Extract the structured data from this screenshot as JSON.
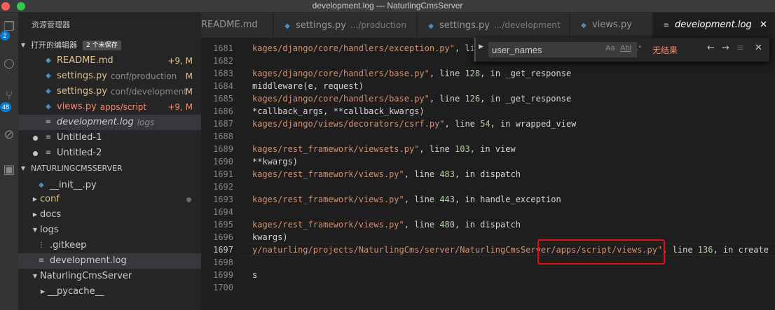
{
  "window": {
    "title": "development.log — NaturlingCmsServer"
  },
  "activity": {
    "badge_top": "2",
    "badge_scm": "48"
  },
  "sidebar": {
    "header": "资源管理器",
    "open_editors": {
      "title": "打开的编辑器",
      "unsaved": "2 个未保存",
      "items": [
        {
          "name": "README.md",
          "dir": "",
          "status": "+9, M"
        },
        {
          "name": "settings.py",
          "dir": "conf/production",
          "status": "M"
        },
        {
          "name": "settings.py",
          "dir": "conf/development",
          "status": "M"
        },
        {
          "name": "views.py",
          "dir": "apps/script",
          "status": "+9, M"
        },
        {
          "name": "development.log",
          "dir": "logs",
          "status": ""
        },
        {
          "name": "Untitled-1",
          "dir": "",
          "status": ""
        },
        {
          "name": "Untitled-2",
          "dir": "",
          "status": ""
        }
      ]
    },
    "project": {
      "title": "NATURLINGCMSSERVER",
      "items": [
        {
          "name": "__init__.py"
        },
        {
          "name": "conf"
        },
        {
          "name": "docs"
        },
        {
          "name": "logs"
        },
        {
          "name": ".gitkeep"
        },
        {
          "name": "development.log"
        },
        {
          "name": "NaturlingCmsServer"
        },
        {
          "name": "__pycache__"
        }
      ]
    }
  },
  "tabs": [
    {
      "label": "README.md",
      "desc": ""
    },
    {
      "label": "settings.py",
      "desc": ".../production"
    },
    {
      "label": "settings.py",
      "desc": ".../development"
    },
    {
      "label": "views.py",
      "desc": ""
    },
    {
      "label": "development.log",
      "desc": ""
    }
  ],
  "find": {
    "value": "user_names",
    "match_case": "Aa",
    "whole_word": "Abl",
    "regex": ".*",
    "no_results": "无结果"
  },
  "editor": {
    "lines": [
      {
        "n": "1681",
        "segs": [
          [
            "s",
            "kages/django/core/handlers/exception.py\""
          ],
          [
            "t",
            ", li"
          ]
        ]
      },
      {
        "n": "1682",
        "segs": []
      },
      {
        "n": "1683",
        "segs": [
          [
            "s",
            "kages/django/core/handlers/base.py\""
          ],
          [
            "t",
            ", line "
          ],
          [
            "n",
            "128"
          ],
          [
            "t",
            ", in _get_response"
          ]
        ]
      },
      {
        "n": "1684",
        "segs": [
          [
            "t",
            "middleware(e, request)"
          ]
        ]
      },
      {
        "n": "1685",
        "segs": [
          [
            "s",
            "kages/django/core/handlers/base.py\""
          ],
          [
            "t",
            ", line "
          ],
          [
            "n",
            "126"
          ],
          [
            "t",
            ", in _get_response"
          ]
        ]
      },
      {
        "n": "1686",
        "segs": [
          [
            "t",
            "*callback_args, **callback_kwargs)"
          ]
        ]
      },
      {
        "n": "1687",
        "segs": [
          [
            "s",
            "kages/django/views/decorators/csrf.py\""
          ],
          [
            "t",
            ", line "
          ],
          [
            "n",
            "54"
          ],
          [
            "t",
            ", in wrapped_view"
          ]
        ]
      },
      {
        "n": "1688",
        "segs": []
      },
      {
        "n": "1689",
        "segs": [
          [
            "s",
            "kages/rest_framework/viewsets.py\""
          ],
          [
            "t",
            ", line "
          ],
          [
            "n",
            "103"
          ],
          [
            "t",
            ", in view"
          ]
        ]
      },
      {
        "n": "1690",
        "segs": [
          [
            "t",
            "**kwargs)"
          ]
        ]
      },
      {
        "n": "1691",
        "segs": [
          [
            "s",
            "kages/rest_framework/views.py\""
          ],
          [
            "t",
            ", line "
          ],
          [
            "n",
            "483"
          ],
          [
            "t",
            ", in dispatch"
          ]
        ]
      },
      {
        "n": "1692",
        "segs": []
      },
      {
        "n": "1693",
        "segs": [
          [
            "s",
            "kages/rest_framework/views.py\""
          ],
          [
            "t",
            ", line "
          ],
          [
            "n",
            "443"
          ],
          [
            "t",
            ", in handle_exception"
          ]
        ]
      },
      {
        "n": "1694",
        "segs": []
      },
      {
        "n": "1695",
        "segs": [
          [
            "s",
            "kages/rest_framework/views.py\""
          ],
          [
            "t",
            ", line "
          ],
          [
            "n",
            "480"
          ],
          [
            "t",
            ", in dispatch"
          ]
        ]
      },
      {
        "n": "1696",
        "segs": [
          [
            "t",
            "kwargs)"
          ]
        ]
      },
      {
        "n": "1697",
        "segs": [
          [
            "s",
            "y/naturling/projects/NaturlingCms/server/NaturlingCmsServer/apps/script/views.py\""
          ],
          [
            "t",
            ", line "
          ],
          [
            "n",
            "136"
          ],
          [
            "t",
            ", in create"
          ]
        ]
      },
      {
        "n": "1698",
        "segs": []
      },
      {
        "n": "1699",
        "segs": [
          [
            "t",
            "s"
          ]
        ]
      },
      {
        "n": "1700",
        "segs": []
      }
    ],
    "current_line": "1697"
  },
  "colors": {
    "accent": "#007acc",
    "error": "#f48771",
    "modified": "#e2c08d",
    "highlight": "#e01010"
  }
}
